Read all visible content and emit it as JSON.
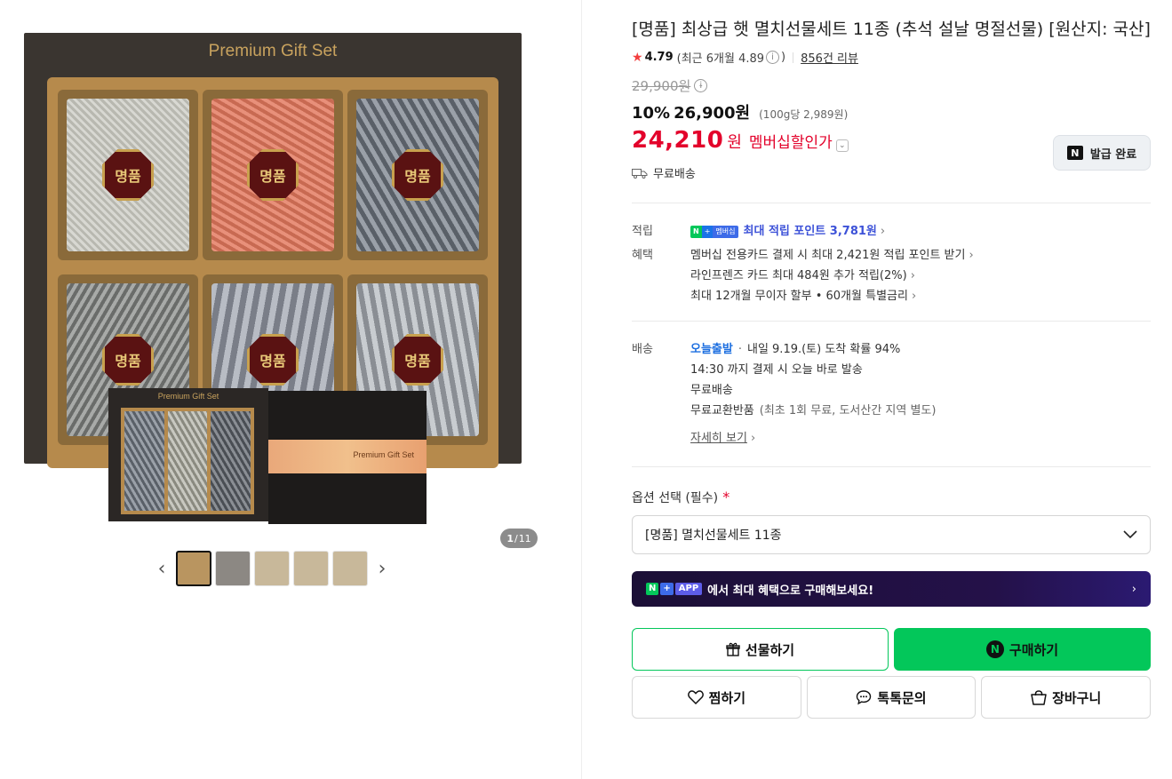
{
  "gallery": {
    "box_title": "Premium Gift Set",
    "emblem_text": "명품",
    "small_box_title": "Premium Gift Set",
    "lid_text": "Premium Gift Set",
    "page_current": "1",
    "page_total": "11",
    "prev_arrow": "‹",
    "next_arrow": "›"
  },
  "product": {
    "title": "[명품] 최상급 햇 멸치선물세트 11종 (추석 설날 명절선물) [원산지: 국산]",
    "rating": "4.79",
    "rating_recent": "(최근 6개월 4.89",
    "rating_recent_close": ")",
    "reviews": "856건 리뷰",
    "original_price": "29,900원",
    "discount": "10%",
    "sale_price": "26,900원",
    "unit_price": "(100g당 2,989원)",
    "member_price": "24,210",
    "member_unit": "원",
    "member_label": "멤버십할인가",
    "coupon_label": "발급 완료",
    "free_shipping": "무료배송"
  },
  "benefits": {
    "points_label": "적립",
    "points_badge_n": "N",
    "points_badge_plus": "+",
    "points_badge_membership": "멤버십",
    "points_text": "최대 적립 포인트 3,781원",
    "perks_label": "혜택",
    "perks": [
      "멤버십 전용카드 결제 시 최대 2,421원 적립 포인트 받기",
      "라인프렌즈 카드 최대 484원 추가 적립(2%)",
      "최대 12개월 무이자 할부 • 60개월 특별금리"
    ]
  },
  "delivery": {
    "label": "배송",
    "today": "오늘출발",
    "eta": "내일 9.19.(토) 도착 확률 94%",
    "cutoff": "14:30 까지 결제 시 오늘 바로 발송",
    "free": "무료배송",
    "exchange": "무료교환반품",
    "exchange_note": "(최초 1회 무료, 도서산간 지역 별도)",
    "details": "자세히 보기"
  },
  "options": {
    "label": "옵션 선택 (필수)",
    "required_mark": "*",
    "selected": "[명품] 멸치선물세트 11종"
  },
  "app_banner": {
    "n": "N",
    "plus": "+",
    "app": "APP",
    "text": "에서 최대 혜택으로 구매해보세요!",
    "arrow": "›"
  },
  "actions": {
    "gift": "선물하기",
    "buy": "구매하기",
    "wish": "찜하기",
    "talk": "톡톡문의",
    "cart": "장바구니"
  },
  "colors": {
    "naver_green": "#03c75a",
    "member_red": "#e3022b",
    "point_blue": "#3d52d8"
  }
}
